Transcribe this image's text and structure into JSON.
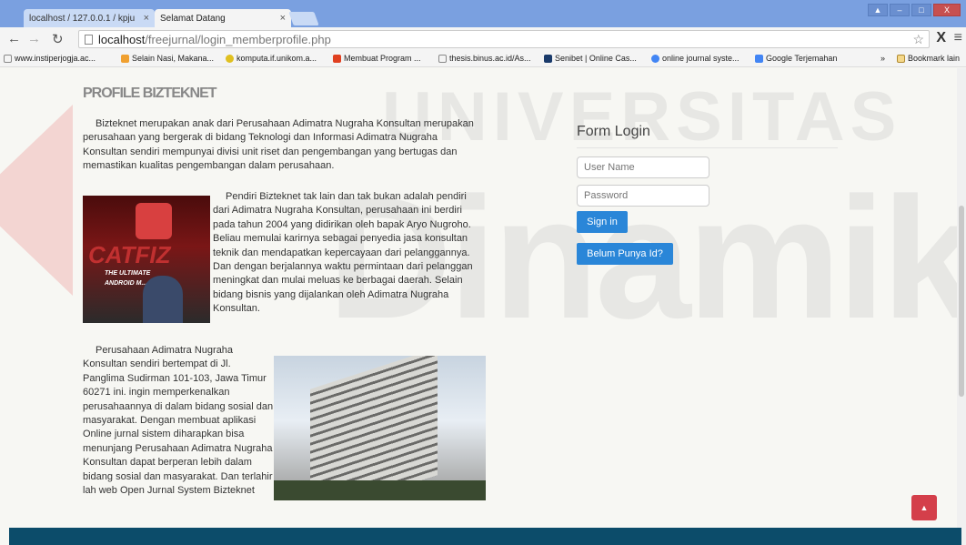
{
  "browser": {
    "tabs": [
      {
        "label": "localhost / 127.0.0.1 / kpju",
        "close": "×"
      },
      {
        "label": "Selamat Datang",
        "close": "×"
      }
    ],
    "window_controls": {
      "restore": "▲",
      "minimize": "–",
      "maximize": "□",
      "close": "X"
    },
    "url_host": "localhost",
    "url_path": "/freejurnal/login_memberprofile.php",
    "bookmarks": [
      "www.instiperjogja.ac...",
      "Selain Nasi, Makana...",
      "komputa.if.unikom.a...",
      "Membuat Program ...",
      "thesis.binus.ac.id/As...",
      "Senibet | Online Cas...",
      "online journal syste...",
      "Google Terjemahan",
      "Bookmark lain"
    ],
    "bookmarks_overflow": "»"
  },
  "page": {
    "title": "PROFILE BIZTEKNET",
    "paragraph1": "Bizteknet merupakan anak dari Perusahaan Adimatra Nugraha Konsultan merupakan perusahaan yang bergerak di bidang Teknologi dan Informasi Adimatra Nugraha Konsultan sendiri mempunyai divisi unit riset dan pengembangan yang bertugas dan memastikan kualitas pengembangan dalam perusahaan.",
    "paragraph2": "Pendiri Bizteknet tak lain dan tak bukan adalah pendiri dari Adimatra Nugraha Konsultan, perusahaan ini berdiri pada tahun 2004 yang didirikan oleh bapak Aryo Nugroho. Beliau memulai karirnya sebagai penyedia jasa konsultan teknik dan mendapatkan kepercayaan dari pelanggannya. Dan dengan berjalannya waktu permintaan dari pelanggan meningkat dan mulai meluas ke berbagai daerah. Selain bidang bisnis yang dijalankan oleh Adimatra Nugraha Konsultan.",
    "paragraph3": "Perusahaan Adimatra Nugraha Konsultan sendiri bertempat di Jl. Panglima Sudirman 101-103, Jawa Timur 60271 ini. ingin memperkenalkan perusahaannya di dalam bidang sosial dan masyarakat. Dengan membuat aplikasi Online jurnal sistem diharapkan bisa menunjang Perusahaan Adimatra Nugraha Konsultan dapat berperan lebih dalam bidang sosial dan masyarakat. Dan terlahir lah web Open Jurnal System Bizteknet",
    "photo1_text": {
      "brand": "CATFIZ",
      "tagline1": "THE ULTIMATE",
      "tagline2": "ANDROID M... NGER"
    }
  },
  "login": {
    "title": "Form Login",
    "username_placeholder": "User Name",
    "password_placeholder": "Password",
    "signin_label": "Sign in",
    "register_label": "Belum Punya Id?"
  },
  "watermark": {
    "line1": "UNIVERSITAS",
    "line2": "Dinamika"
  },
  "scroll_top_label": "▲",
  "colors": {
    "accent": "#2a86d8",
    "scroll_top": "#d43f4a",
    "footer": "#0c4c6a"
  }
}
